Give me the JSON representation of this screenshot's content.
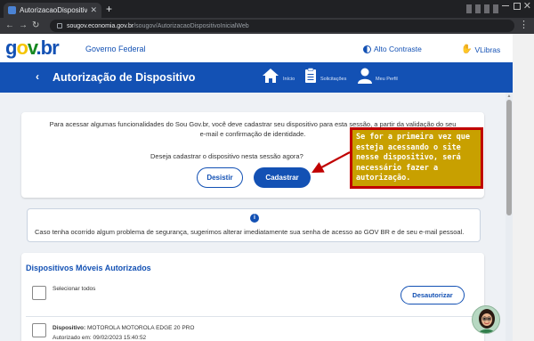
{
  "browser": {
    "tab_title": "AutorizacaoDispositivoIni",
    "url_host": "sougov.economia.gov.br",
    "url_path": "/sougov/AutorizacaoDispositivoInicialWeb"
  },
  "header": {
    "logo": {
      "g": "g",
      "o": "o",
      "v": "v",
      "dot": ".",
      "br": "br"
    },
    "gov_label": "Governo Federal",
    "contrast_label": "Alto Contraste",
    "vlibras_label": "VLibras"
  },
  "navbar": {
    "title": "Autorização de Dispositivo",
    "items": [
      {
        "label": "Início",
        "icon": "home-icon"
      },
      {
        "label": "Solicitações",
        "icon": "clipboard-icon"
      },
      {
        "label": "Meu Perfil",
        "icon": "user-icon"
      }
    ]
  },
  "authorize_card": {
    "intro": "Para acessar algumas funcionalidades do Sou Gov.br, você deve cadastrar seu dispositivo para esta sessão, a partir da validação do seu e-mail e confirmação de identidade.",
    "question": "Deseja cadastrar o dispositivo nesta sessão agora?",
    "cancel_label": "Desistir",
    "register_label": "Cadastrar"
  },
  "info_card": {
    "icon": "info-icon",
    "text": "Caso tenha ocorrido algum problema de segurança, sugerimos alterar imediatamente sua senha de acesso ao GOV BR e de seu e-mail pessoal."
  },
  "devices_card": {
    "title": "Dispositivos Móveis Autorizados",
    "select_all_label": "Selecionar todos",
    "deauthorize_label": "Desautorizar",
    "devices": [
      {
        "label": "Dispositivo:",
        "name": "MOTOROLA MOTOROLA EDGE 20 PRO",
        "authorized_label": "Autorizado em:",
        "authorized_at": "09/02/2023 15:40:52"
      }
    ]
  },
  "annotation": {
    "text": "Se for a primeira vez que esteja acessando o site nesse dispositivo, será necessário fazer a autorização."
  },
  "colors": {
    "brand_blue": "#1351b4",
    "callout_fill": "#c8a000",
    "callout_border": "#c00000"
  }
}
